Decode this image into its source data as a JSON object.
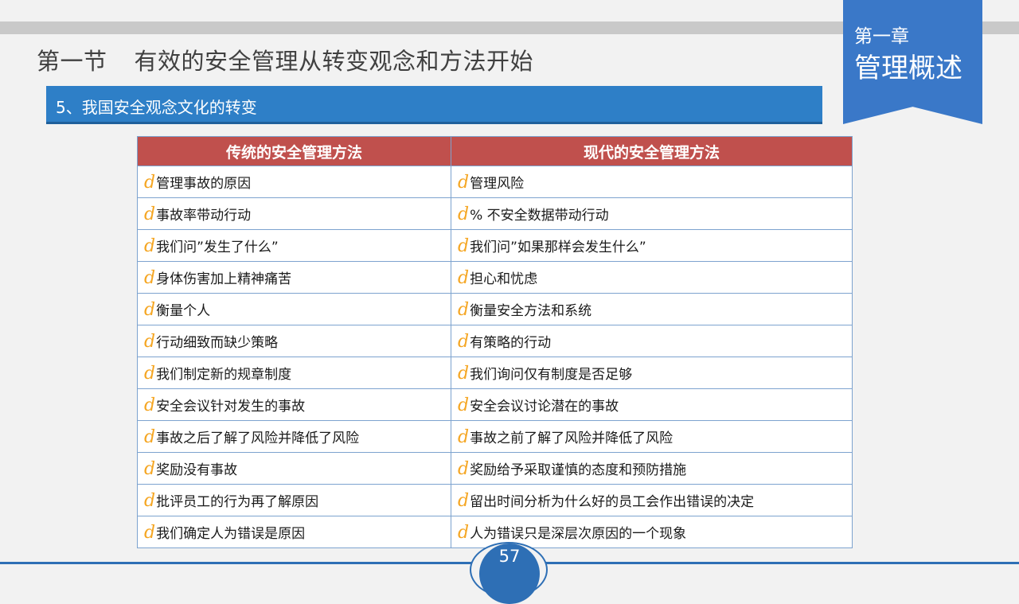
{
  "header": {
    "section_label": "第一节",
    "section_title": "有效的安全管理从转变观念和方法开始"
  },
  "subtitle": "5、我国安全观念文化的转变",
  "chapter": {
    "number": "第一章",
    "name": "管理概述"
  },
  "table": {
    "bullet": "d",
    "headers": [
      "传统的安全管理方法",
      "现代的安全管理方法"
    ],
    "rows": [
      [
        "管理事故的原因",
        "管理风险"
      ],
      [
        "事故率带动行动",
        "% 不安全数据带动行动"
      ],
      [
        "我们问”发生了什么”",
        "我们问”如果那样会发生什么”"
      ],
      [
        "身体伤害加上精神痛苦",
        "担心和忧虑"
      ],
      [
        "衡量个人",
        "衡量安全方法和系统"
      ],
      [
        "行动细致而缺少策略",
        "有策略的行动"
      ],
      [
        "我们制定新的规章制度",
        "我们询问仅有制度是否足够"
      ],
      [
        "安全会议针对发生的事故",
        "安全会议讨论潜在的事故"
      ],
      [
        "事故之后了解了风险并降低了风险",
        "事故之前了解了风险并降低了风险"
      ],
      [
        "奖励没有事故",
        "奖励给予采取谨慎的态度和预防措施"
      ],
      [
        "批评员工的行为再了解原因",
        "留出时间分析为什么好的员工会作出错误的决定"
      ],
      [
        "我们确定人为错误是原因",
        "人为错误只是深层次原因的一个现象"
      ]
    ]
  },
  "footer": {
    "page_number": "57"
  },
  "colors": {
    "header_bar": "#2e7fc7",
    "chapter_badge": "#3a78c8",
    "table_header": "#c0504d",
    "bullet": "#f5a623",
    "table_border": "#7da3cf"
  }
}
